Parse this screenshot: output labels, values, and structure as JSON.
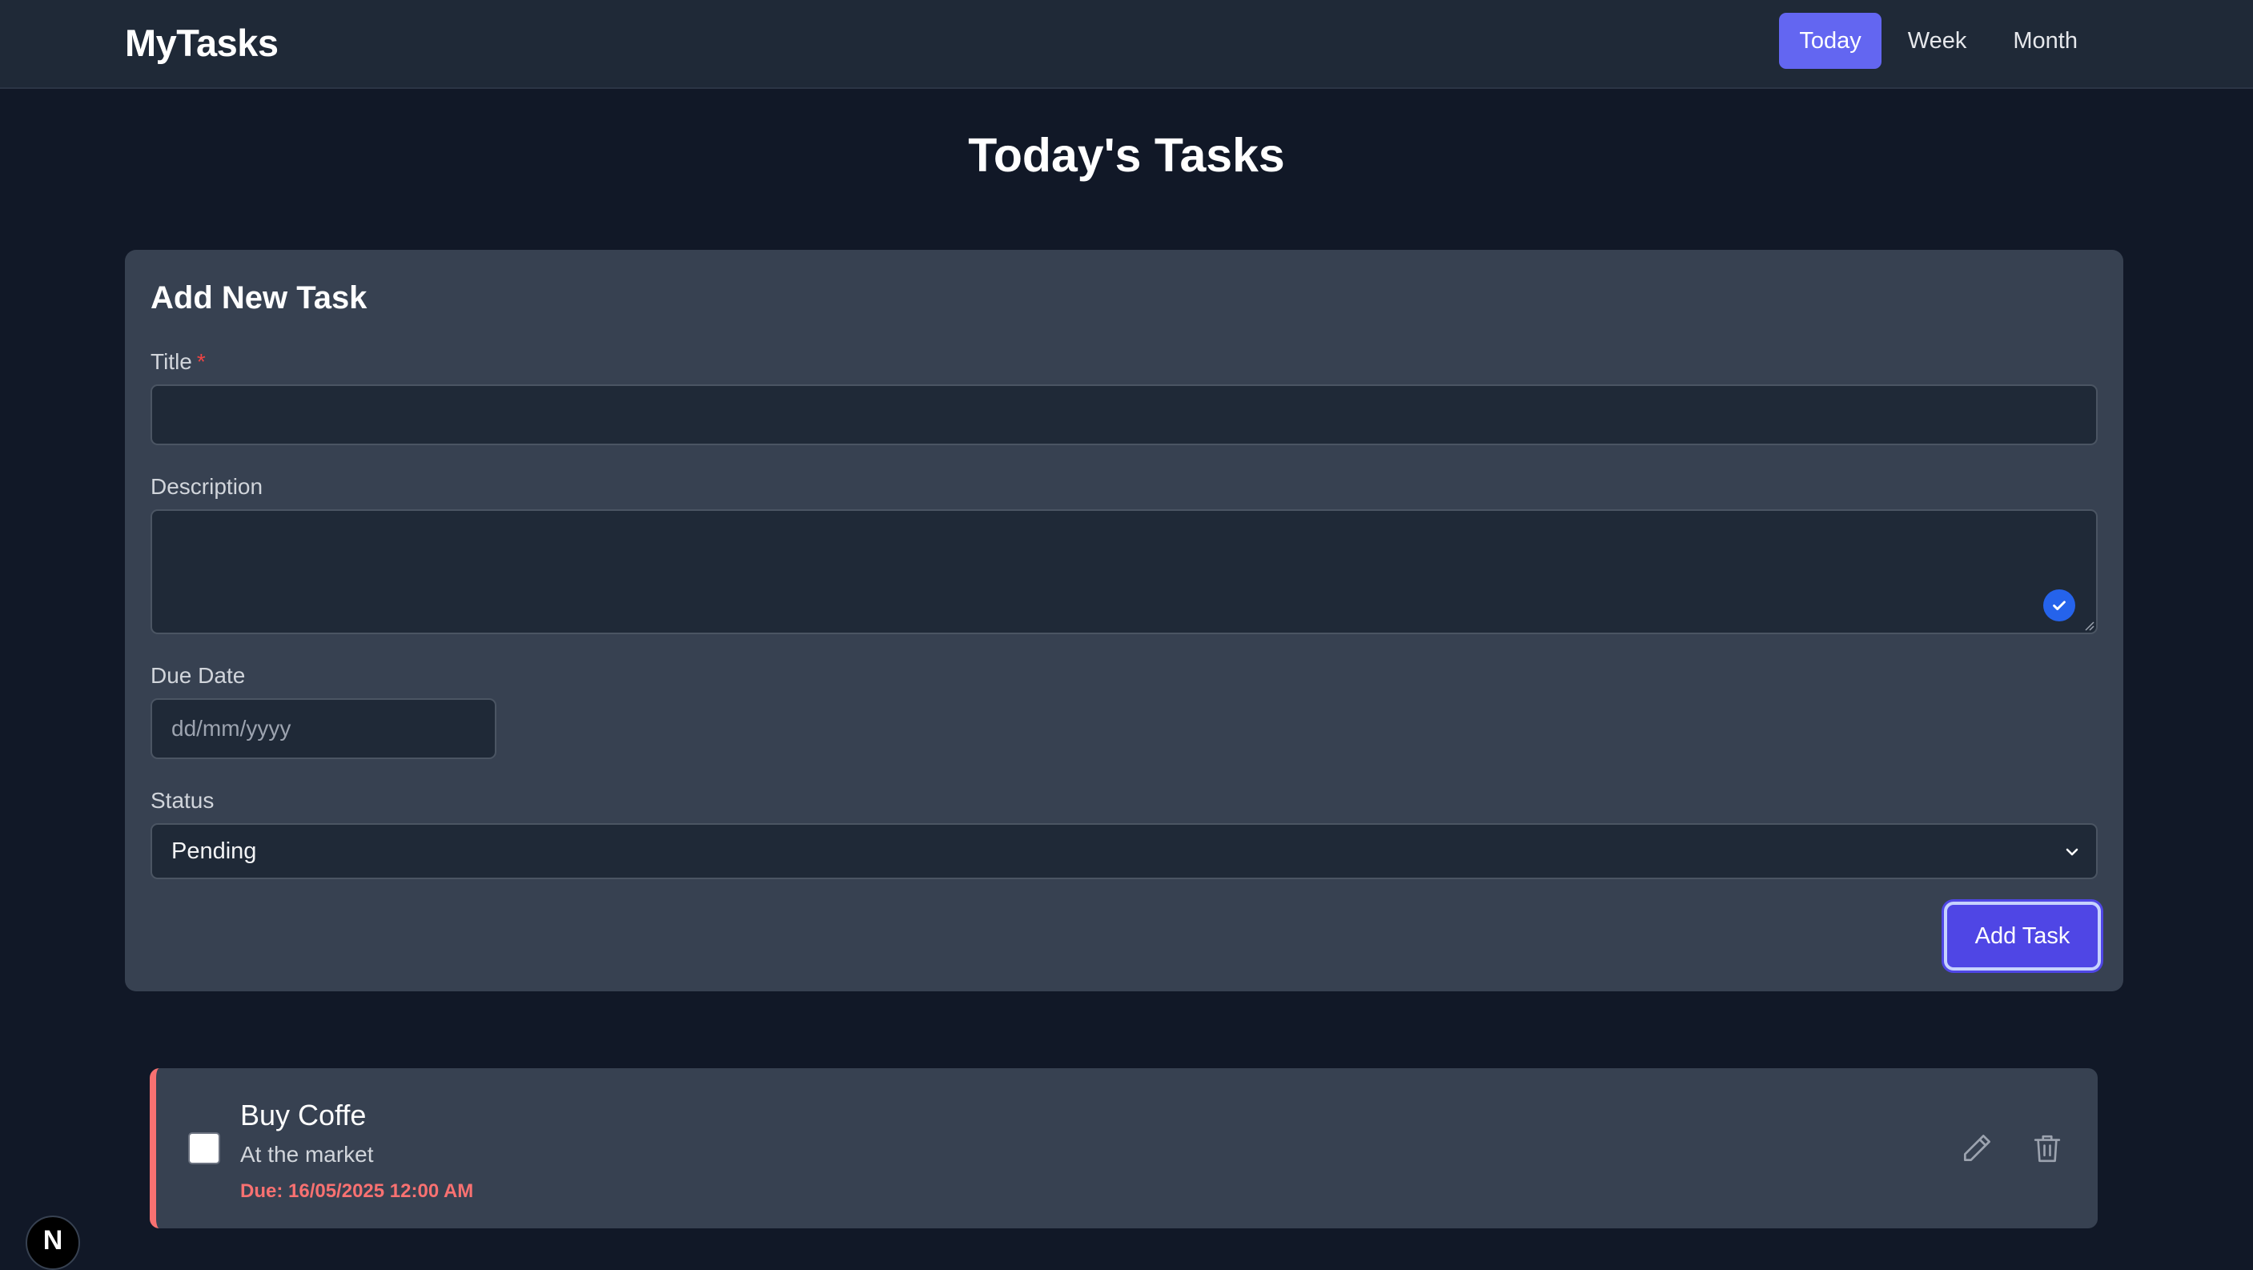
{
  "app": {
    "brand": "MyTasks"
  },
  "nav": {
    "tabs": [
      {
        "label": "Today",
        "active": true
      },
      {
        "label": "Week",
        "active": false
      },
      {
        "label": "Month",
        "active": false
      }
    ]
  },
  "page": {
    "title": "Today's Tasks"
  },
  "form": {
    "heading": "Add New Task",
    "title_label": "Title",
    "required_mark": "*",
    "title_value": "",
    "description_label": "Description",
    "description_value": "",
    "due_date_label": "Due Date",
    "due_date_placeholder": "dd/mm/yyyy",
    "status_label": "Status",
    "status_selected": "Pending",
    "submit_label": "Add Task"
  },
  "tasks": [
    {
      "title": "Buy Coffe",
      "description": "At the market",
      "due": "Due: 16/05/2025 12:00 AM",
      "completed": false
    }
  ],
  "colors": {
    "accent": "#6366f1",
    "submit": "#4f46e5",
    "overdue": "#f87171",
    "background": "#111827",
    "card": "#374151"
  },
  "icons": [
    "pencil-icon",
    "trash-icon",
    "check-icon",
    "chevron-down-icon"
  ],
  "badge": {
    "letter": "N"
  }
}
